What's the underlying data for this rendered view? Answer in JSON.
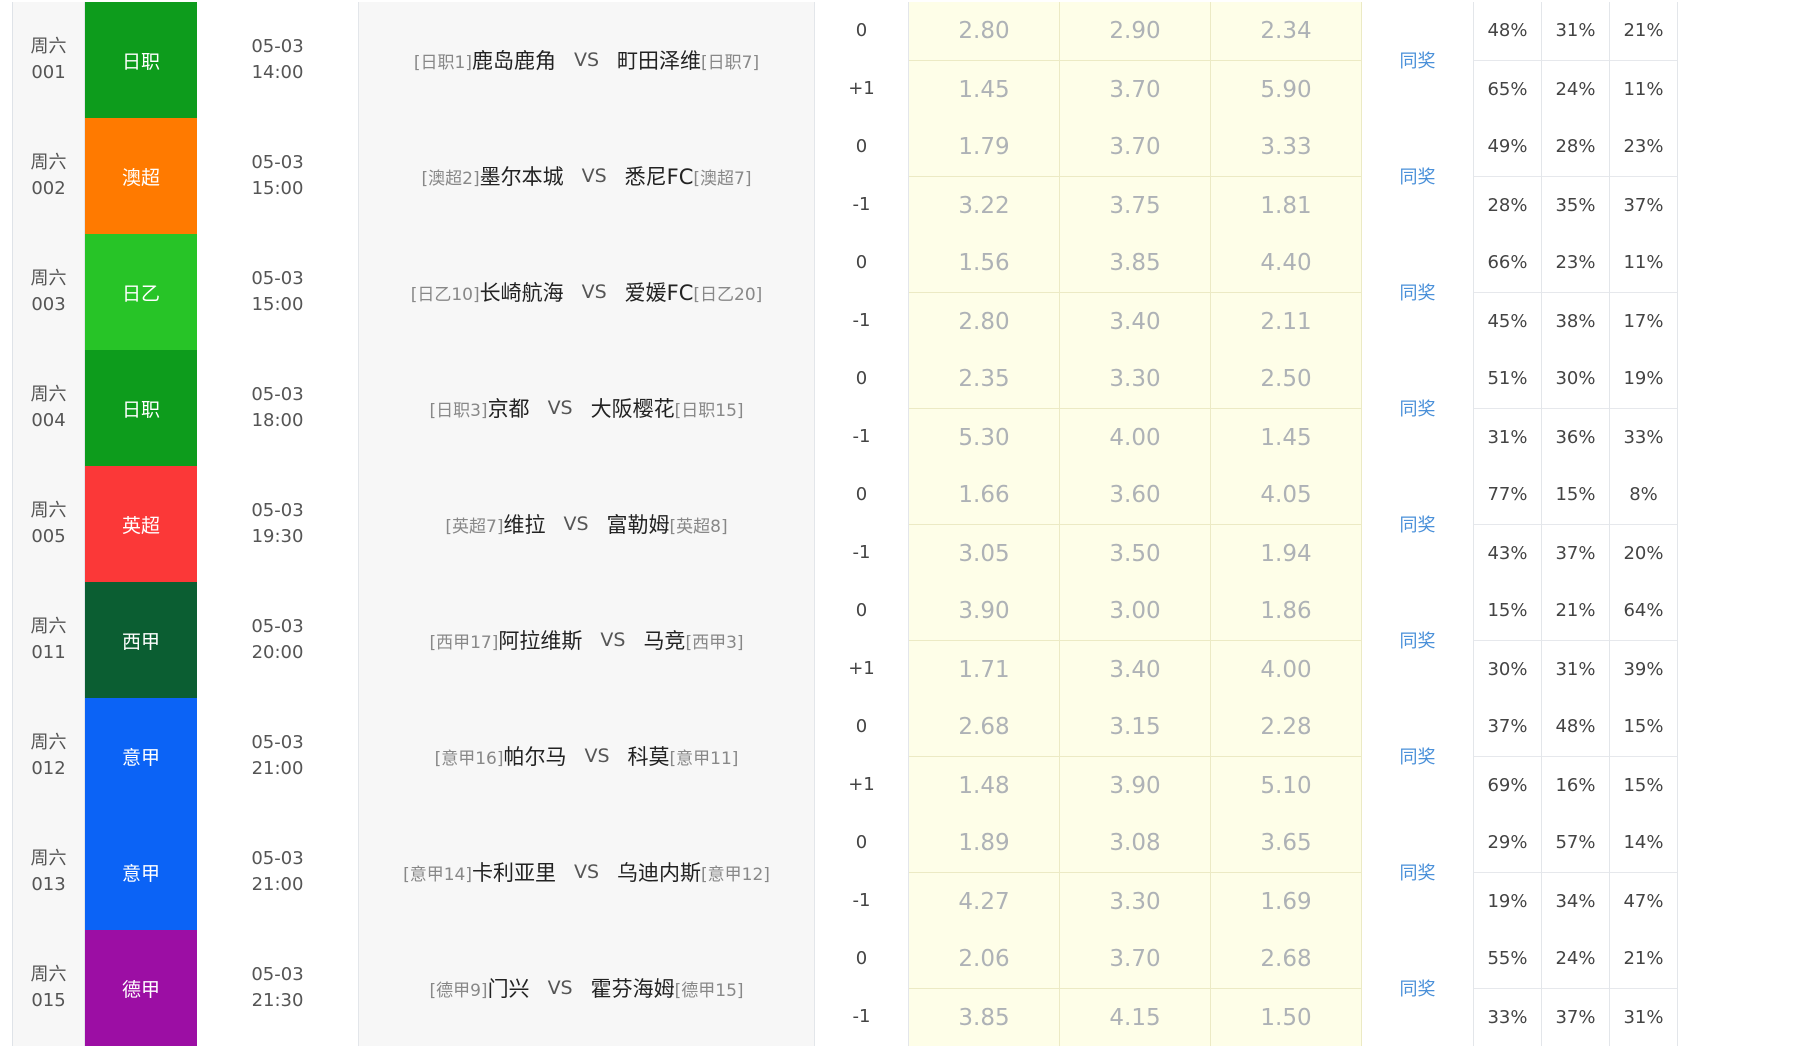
{
  "same_label": "同奖",
  "vs_label": "VS",
  "matches": [
    {
      "weekday": "周六",
      "num": "001",
      "league": "日职",
      "league_color": "#0d9c1c",
      "date": "05-03",
      "time": "14:00",
      "home_rank": "[日职1]",
      "home": "鹿岛鹿角",
      "away": "町田泽维",
      "away_rank": "[日职7]",
      "hc": [
        "0",
        "+1"
      ],
      "odds": [
        [
          "2.80",
          "2.90",
          "2.34"
        ],
        [
          "1.45",
          "3.70",
          "5.90"
        ]
      ],
      "pct": [
        [
          "48%",
          "31%",
          "21%"
        ],
        [
          "65%",
          "24%",
          "11%"
        ]
      ]
    },
    {
      "weekday": "周六",
      "num": "002",
      "league": "澳超",
      "league_color": "#ff7a00",
      "date": "05-03",
      "time": "15:00",
      "home_rank": "[澳超2]",
      "home": "墨尔本城",
      "away": "悉尼FC",
      "away_rank": "[澳超7]",
      "hc": [
        "0",
        "-1"
      ],
      "odds": [
        [
          "1.79",
          "3.70",
          "3.33"
        ],
        [
          "3.22",
          "3.75",
          "1.81"
        ]
      ],
      "pct": [
        [
          "49%",
          "28%",
          "23%"
        ],
        [
          "28%",
          "35%",
          "37%"
        ]
      ]
    },
    {
      "weekday": "周六",
      "num": "003",
      "league": "日乙",
      "league_color": "#27c427",
      "date": "05-03",
      "time": "15:00",
      "home_rank": "[日乙10]",
      "home": "长崎航海",
      "away": "爱媛FC",
      "away_rank": "[日乙20]",
      "hc": [
        "0",
        "-1"
      ],
      "odds": [
        [
          "1.56",
          "3.85",
          "4.40"
        ],
        [
          "2.80",
          "3.40",
          "2.11"
        ]
      ],
      "pct": [
        [
          "66%",
          "23%",
          "11%"
        ],
        [
          "45%",
          "38%",
          "17%"
        ]
      ]
    },
    {
      "weekday": "周六",
      "num": "004",
      "league": "日职",
      "league_color": "#0d9c1c",
      "date": "05-03",
      "time": "18:00",
      "home_rank": "[日职3]",
      "home": "京都",
      "away": "大阪樱花",
      "away_rank": "[日职15]",
      "hc": [
        "0",
        "-1"
      ],
      "odds": [
        [
          "2.35",
          "3.30",
          "2.50"
        ],
        [
          "5.30",
          "4.00",
          "1.45"
        ]
      ],
      "pct": [
        [
          "51%",
          "30%",
          "19%"
        ],
        [
          "31%",
          "36%",
          "33%"
        ]
      ]
    },
    {
      "weekday": "周六",
      "num": "005",
      "league": "英超",
      "league_color": "#fb3838",
      "date": "05-03",
      "time": "19:30",
      "home_rank": "[英超7]",
      "home": "维拉",
      "away": "富勒姆",
      "away_rank": "[英超8]",
      "hc": [
        "0",
        "-1"
      ],
      "odds": [
        [
          "1.66",
          "3.60",
          "4.05"
        ],
        [
          "3.05",
          "3.50",
          "1.94"
        ]
      ],
      "pct": [
        [
          "77%",
          "15%",
          "8%"
        ],
        [
          "43%",
          "37%",
          "20%"
        ]
      ]
    },
    {
      "weekday": "周六",
      "num": "011",
      "league": "西甲",
      "league_color": "#0b5e32",
      "date": "05-03",
      "time": "20:00",
      "home_rank": "[西甲17]",
      "home": "阿拉维斯",
      "away": "马竞",
      "away_rank": "[西甲3]",
      "hc": [
        "0",
        "+1"
      ],
      "odds": [
        [
          "3.90",
          "3.00",
          "1.86"
        ],
        [
          "1.71",
          "3.40",
          "4.00"
        ]
      ],
      "pct": [
        [
          "15%",
          "21%",
          "64%"
        ],
        [
          "30%",
          "31%",
          "39%"
        ]
      ]
    },
    {
      "weekday": "周六",
      "num": "012",
      "league": "意甲",
      "league_color": "#0b63f6",
      "date": "05-03",
      "time": "21:00",
      "home_rank": "[意甲16]",
      "home": "帕尔马",
      "away": "科莫",
      "away_rank": "[意甲11]",
      "hc": [
        "0",
        "+1"
      ],
      "odds": [
        [
          "2.68",
          "3.15",
          "2.28"
        ],
        [
          "1.48",
          "3.90",
          "5.10"
        ]
      ],
      "pct": [
        [
          "37%",
          "48%",
          "15%"
        ],
        [
          "69%",
          "16%",
          "15%"
        ]
      ]
    },
    {
      "weekday": "周六",
      "num": "013",
      "league": "意甲",
      "league_color": "#0b63f6",
      "date": "05-03",
      "time": "21:00",
      "home_rank": "[意甲14]",
      "home": "卡利亚里",
      "away": "乌迪内斯",
      "away_rank": "[意甲12]",
      "hc": [
        "0",
        "-1"
      ],
      "odds": [
        [
          "1.89",
          "3.08",
          "3.65"
        ],
        [
          "4.27",
          "3.30",
          "1.69"
        ]
      ],
      "pct": [
        [
          "29%",
          "57%",
          "14%"
        ],
        [
          "19%",
          "34%",
          "47%"
        ]
      ]
    },
    {
      "weekday": "周六",
      "num": "015",
      "league": "德甲",
      "league_color": "#9c0ea4",
      "date": "05-03",
      "time": "21:30",
      "home_rank": "[德甲9]",
      "home": "门兴",
      "away": "霍芬海姆",
      "away_rank": "[德甲15]",
      "hc": [
        "0",
        "-1"
      ],
      "odds": [
        [
          "2.06",
          "3.70",
          "2.68"
        ],
        [
          "3.85",
          "4.15",
          "1.50"
        ]
      ],
      "pct": [
        [
          "55%",
          "24%",
          "21%"
        ],
        [
          "33%",
          "37%",
          "31%"
        ]
      ]
    }
  ]
}
